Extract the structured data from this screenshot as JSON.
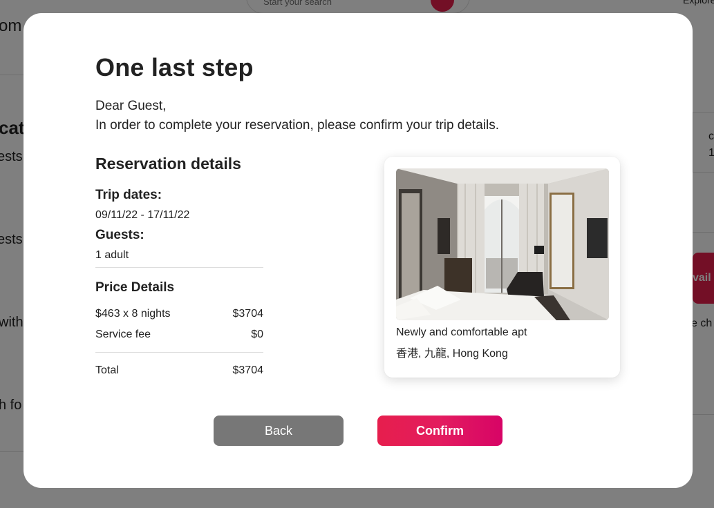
{
  "background": {
    "search_placeholder": "Start your search",
    "explore_label": "Explore",
    "fragments": [
      "om",
      "cat",
      "ests",
      "ests",
      "with",
      "h fo",
      "c",
      "1",
      "vail",
      "e ch"
    ]
  },
  "modal": {
    "title": "One last step",
    "greeting": "Dear Guest,",
    "intro": "In order to complete your reservation, please confirm your trip details.",
    "reservation": {
      "heading": "Reservation details",
      "trip_dates_label": "Trip dates:",
      "trip_dates_value": "09/11/22 - 17/11/22",
      "guests_label": "Guests:",
      "guests_value": "1 adult"
    },
    "price": {
      "heading": "Price Details",
      "nightly_label": "$463 x 8 nights",
      "nightly_amount": "$3704",
      "fee_label": "Service fee",
      "fee_amount": "$0",
      "total_label": "Total",
      "total_amount": "$3704"
    },
    "listing": {
      "name": "Newly and comfortable apt",
      "location": "香港, 九龍, Hong Kong"
    },
    "buttons": {
      "back": "Back",
      "confirm": "Confirm"
    }
  },
  "colors": {
    "brand": "#e61e4d",
    "back_button": "#777777",
    "text": "#222222",
    "divider": "#dddddd"
  }
}
